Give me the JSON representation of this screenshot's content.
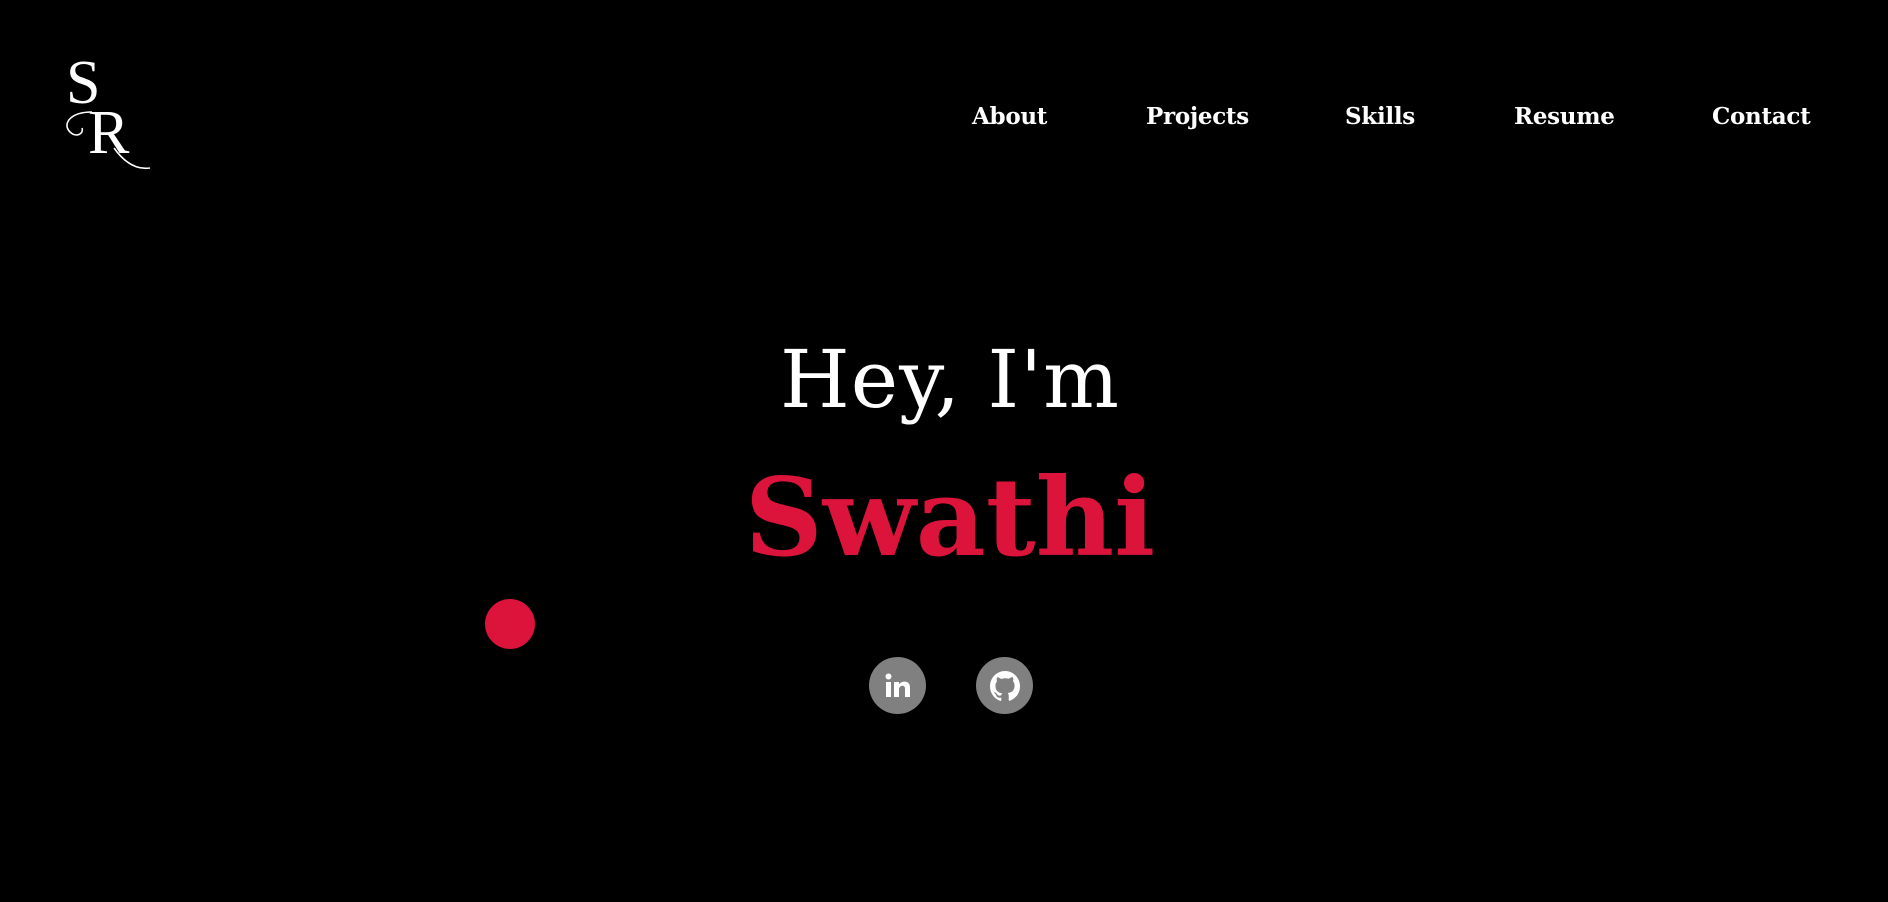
{
  "logo": {
    "letters": [
      "S",
      "R"
    ]
  },
  "nav": {
    "items": [
      {
        "label": "About"
      },
      {
        "label": "Projects"
      },
      {
        "label": "Skills"
      },
      {
        "label": "Resume"
      },
      {
        "label": "Contact"
      }
    ]
  },
  "hero": {
    "greeting": "Hey, I'm",
    "name": "Swathi"
  },
  "social": [
    {
      "icon": "linkedin-icon"
    },
    {
      "icon": "github-icon"
    }
  ],
  "colors": {
    "background": "#000000",
    "text": "#ffffff",
    "accent": "#dc143c",
    "social_bg": "#808080"
  }
}
